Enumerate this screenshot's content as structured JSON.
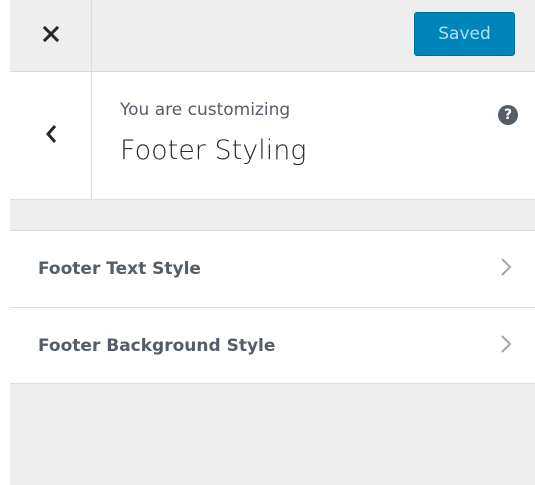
{
  "header": {
    "save_label": "Saved",
    "close_icon": "close-icon"
  },
  "section": {
    "customizing_label": "You are customizing",
    "title": "Footer Styling",
    "back_icon": "chevron-left-icon",
    "help_glyph": "?"
  },
  "menu": {
    "items": [
      {
        "label": "Footer Text Style"
      },
      {
        "label": "Footer Background Style"
      }
    ]
  },
  "colors": {
    "accent": "#0085ba",
    "panel_bg": "#eeeeee",
    "text": "#555d66"
  }
}
